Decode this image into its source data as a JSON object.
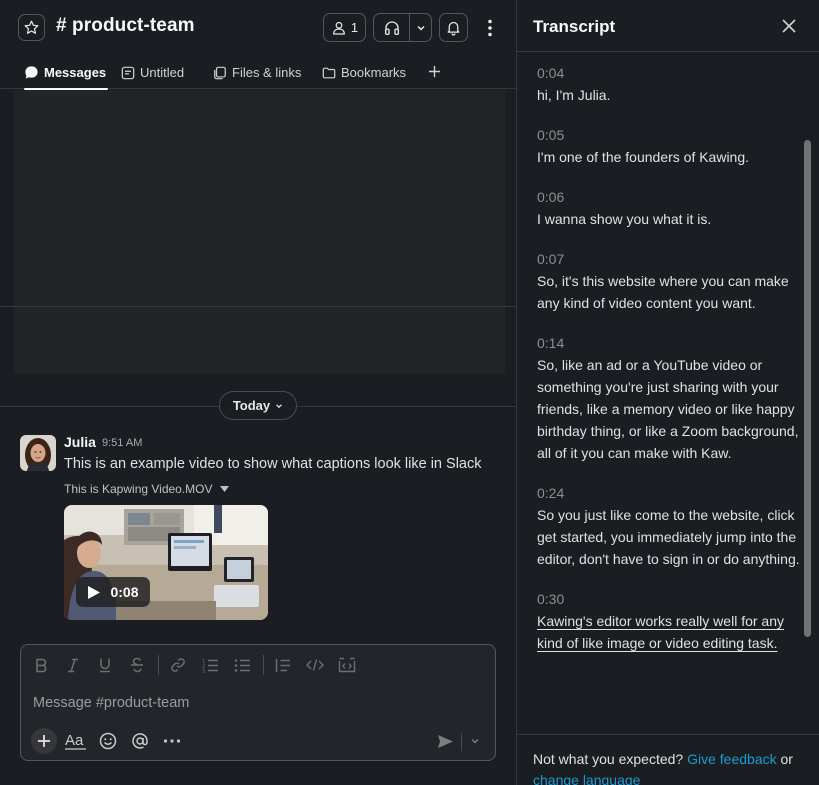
{
  "header": {
    "channel_title": "# product-team",
    "member_count": "1"
  },
  "tabs": [
    {
      "label": "Messages",
      "icon": "message-bubble-icon",
      "active": true
    },
    {
      "label": "Untitled",
      "icon": "canvas-icon"
    },
    {
      "label": "Files & links",
      "icon": "files-icon"
    },
    {
      "label": "Bookmarks",
      "icon": "folder-icon"
    }
  ],
  "divider": {
    "label": "Today"
  },
  "message": {
    "author": "Julia",
    "time": "9:51 AM",
    "text": "This is an example video to show what captions look like in Slack",
    "file_name": "This is Kapwing Video.MOV",
    "duration": "0:08"
  },
  "composer": {
    "placeholder": "Message #product-team",
    "format_icons": [
      "bold-icon",
      "italic-icon",
      "underline-icon",
      "strikethrough-icon",
      "link-icon",
      "ordered-list-icon",
      "bulleted-list-icon",
      "blockquote-icon",
      "code-icon",
      "code-block-icon"
    ]
  },
  "transcript": {
    "title": "Transcript",
    "entries": [
      {
        "time": "0:04",
        "text": "hi, I'm Julia."
      },
      {
        "time": "0:05",
        "text": "I'm one of the founders of Kawing."
      },
      {
        "time": "0:06",
        "text": "I wanna show you what it is."
      },
      {
        "time": "0:07",
        "text": "So, it's this website where you can make any kind of video content you want."
      },
      {
        "time": "0:14",
        "text": "So, like an ad or a YouTube video or something you're just sharing with your friends, like a memory video or like happy birthday thing, or like a Zoom background, all of it you can make with Kaw."
      },
      {
        "time": "0:24",
        "text": "So you just like come to the website, click get started, you immediately jump into the editor, don't have to sign in or do anything."
      },
      {
        "time": "0:30",
        "text": "Kawing's editor works really well for any kind of like image or video editing task.",
        "current": true
      }
    ],
    "footer": {
      "prefix": "Not what you expected?",
      "feedback_link": "Give feedback",
      "middle": "or",
      "language_link": "change language"
    }
  },
  "colors": {
    "background": "#1a1d21",
    "link": "#1d9bd1",
    "border": "#35373b"
  }
}
